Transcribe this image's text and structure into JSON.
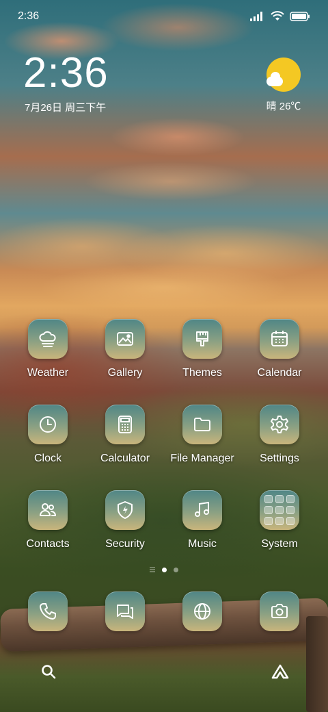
{
  "status_bar": {
    "time": "2:36"
  },
  "clock_widget": {
    "time": "2:36",
    "date": "7月26日 周三下午"
  },
  "weather_widget": {
    "text": "晴 26℃",
    "icon": "partly-sunny-icon"
  },
  "apps": [
    {
      "label": "Weather",
      "icon": "weather-icon"
    },
    {
      "label": "Gallery",
      "icon": "gallery-icon"
    },
    {
      "label": "Themes",
      "icon": "brush-icon"
    },
    {
      "label": "Calendar",
      "icon": "calendar-icon"
    },
    {
      "label": "Clock",
      "icon": "clock-icon"
    },
    {
      "label": "Calculator",
      "icon": "calculator-icon"
    },
    {
      "label": "File Manager",
      "icon": "folder-icon"
    },
    {
      "label": "Settings",
      "icon": "gear-icon"
    },
    {
      "label": "Contacts",
      "icon": "contacts-icon"
    },
    {
      "label": "Security",
      "icon": "shield-icon"
    },
    {
      "label": "Music",
      "icon": "music-note-icon"
    },
    {
      "label": "System",
      "icon": "folder-grid-icon"
    }
  ],
  "dock": [
    {
      "icon": "phone-icon"
    },
    {
      "icon": "messages-icon"
    },
    {
      "icon": "browser-globe-icon"
    },
    {
      "icon": "camera-icon"
    }
  ],
  "bottom_bar": [
    {
      "icon": "search-icon"
    },
    {
      "icon": "launcher-triangle-icon"
    }
  ],
  "page_indicator": {
    "pages": 2,
    "active_page": 1
  },
  "colors": {
    "sun": "#f4c823",
    "icon_top": "#4f8686",
    "icon_bottom": "#c9b57c"
  }
}
